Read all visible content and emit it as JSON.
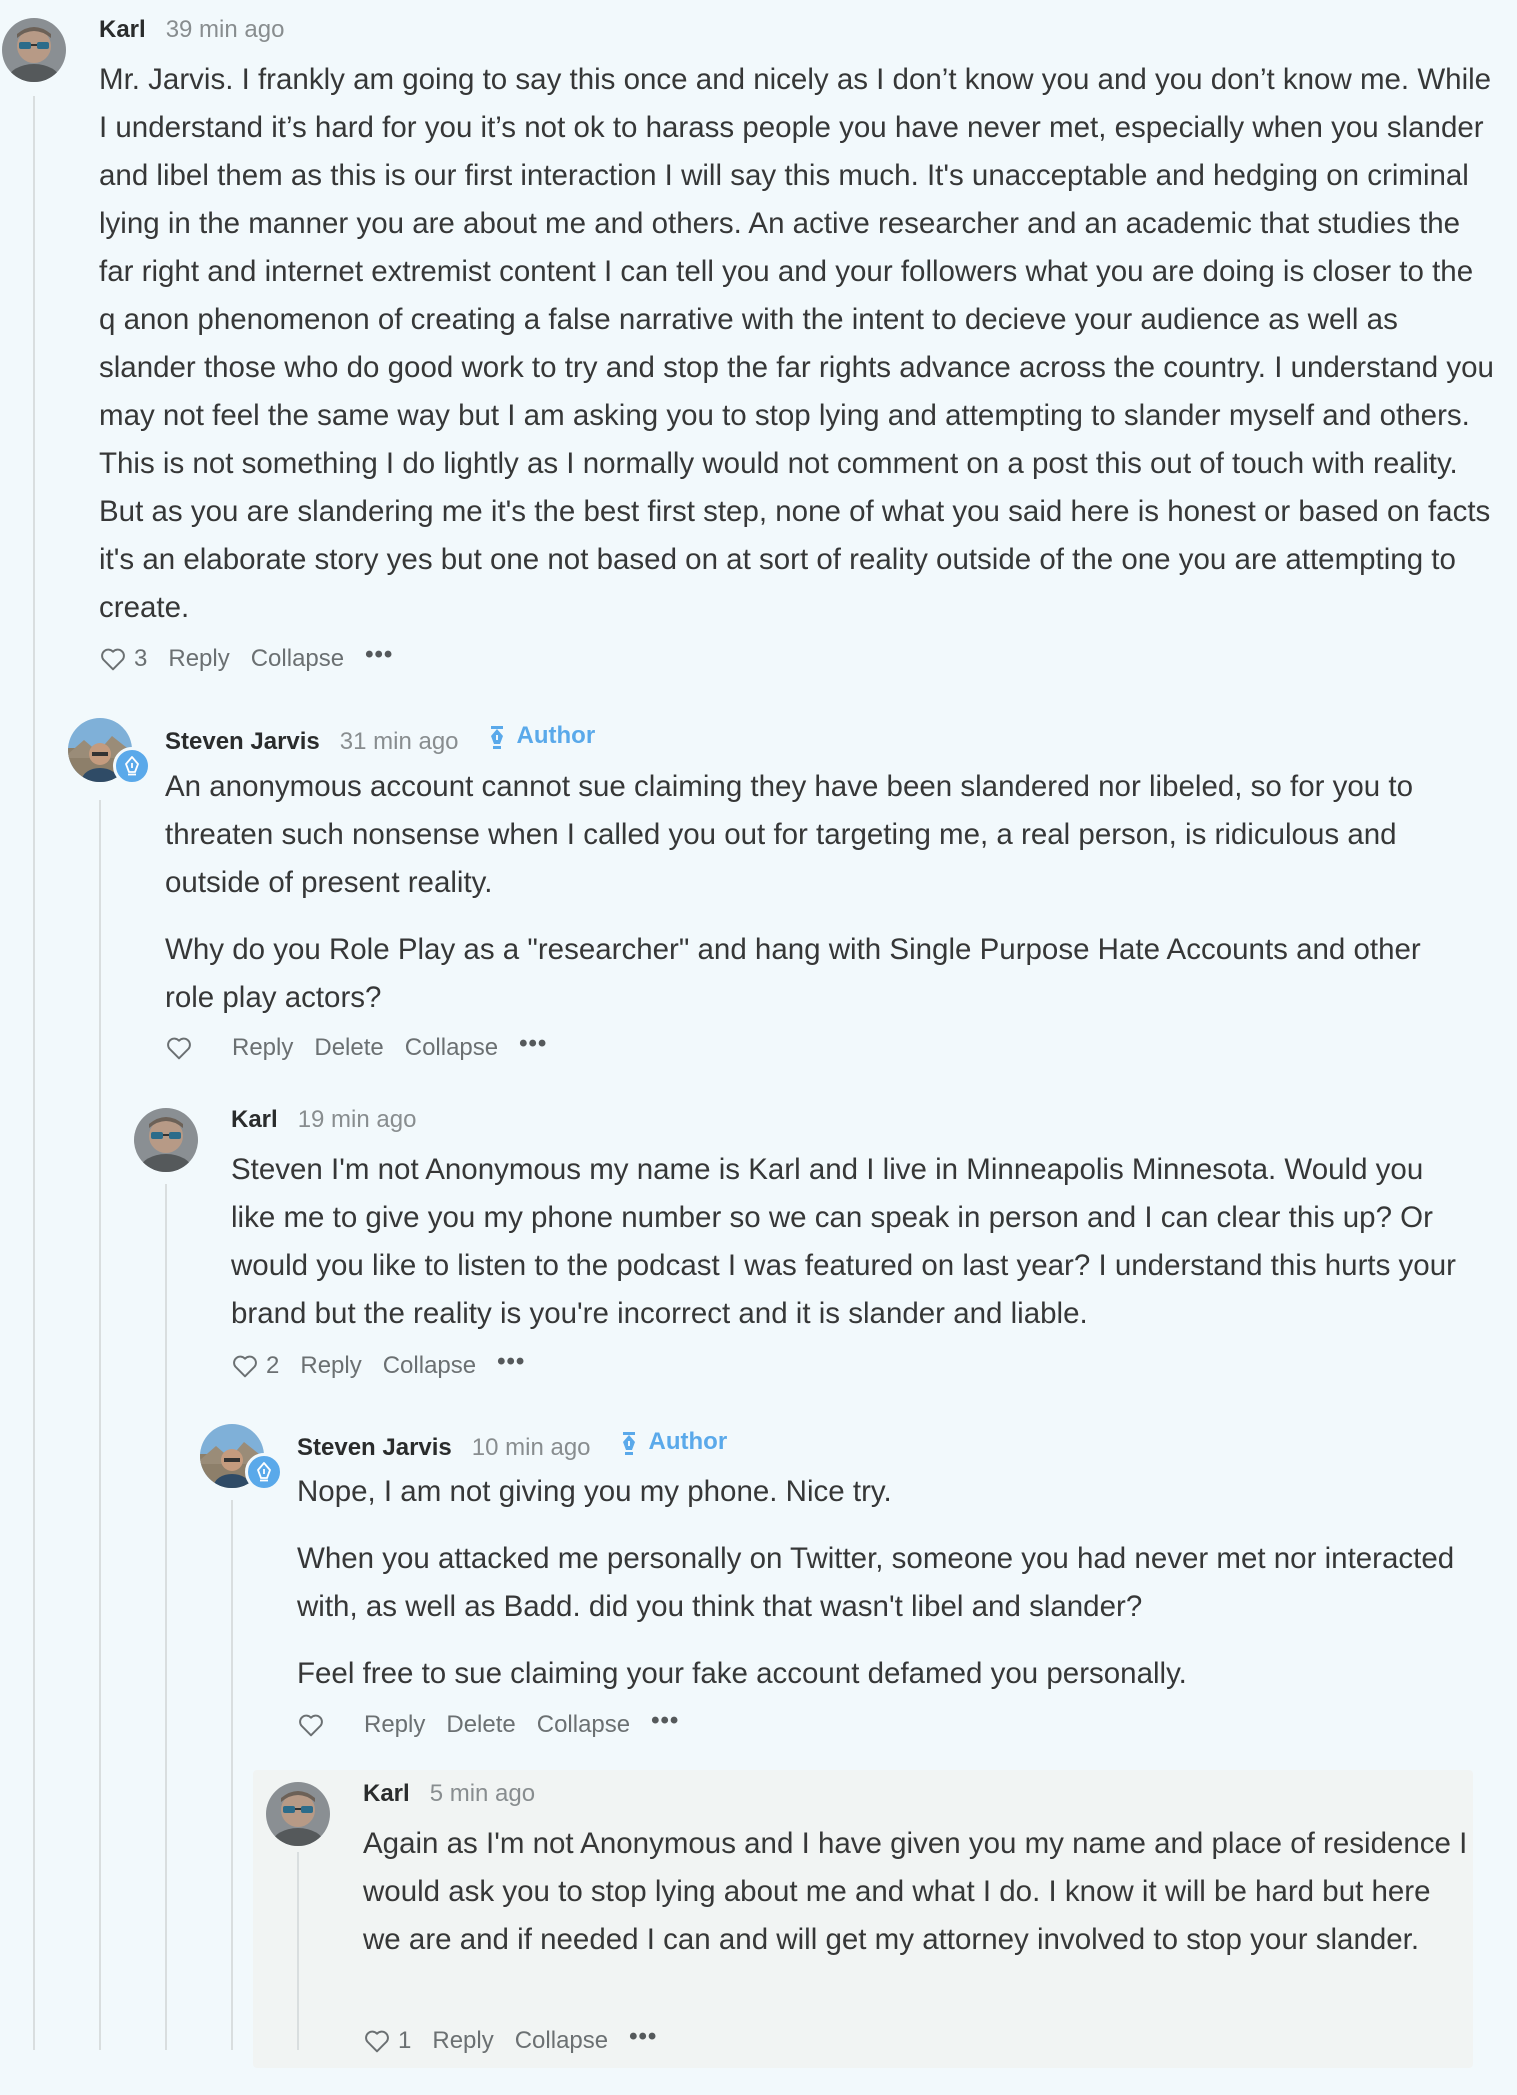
{
  "comments": [
    {
      "name": "Karl",
      "time": "39 min ago",
      "paragraphs": [
        "Mr. Jarvis. I frankly am going to say this once and nicely as I don’t know you and you don’t know me. While I understand it’s hard for you it’s not ok to harass people you have never met, especially when you slander and libel them as this is our first interaction I will say this much. It's unacceptable and hedging on criminal lying in the manner you are about me and others. An active researcher and an academic that studies the far right and internet extremist content I can tell you and your followers what you are doing is closer to the q anon phenomenon of creating a false narrative with the intent to decieve your audience as well as slander those who do good work to try and stop the far rights advance across the country. I understand you may not feel the same way but I am asking you to stop lying and attempting to slander myself and others. This is not something I do lightly as I normally would not comment on a post this out of touch with reality. But as you are slandering me it's the best first step, none of what you said here is honest or based on facts it's an elaborate story yes but one not based on at sort of reality outside of the one you are attempting to create."
      ],
      "likes": "3",
      "reply": "Reply",
      "collapse": "Collapse",
      "more": "•••"
    },
    {
      "name": "Steven Jarvis",
      "time": "31 min ago",
      "author_tag": "Author",
      "paragraphs": [
        "An anonymous account cannot sue claiming they have been slandered nor libeled, so for you to threaten such nonsense when I called you out for targeting me, a real person, is ridiculous and outside of present reality.",
        "Why do you Role Play as a \"researcher\" and hang with Single Purpose Hate Accounts and other role play actors?"
      ],
      "reply": "Reply",
      "delete": "Delete",
      "collapse": "Collapse",
      "more": "•••"
    },
    {
      "name": "Karl",
      "time": "19 min ago",
      "paragraphs": [
        "Steven I'm not Anonymous my name is Karl and I live in Minneapolis Minnesota. Would you like me to give you my phone number so we can speak in person and I can clear this up? Or would you like to listen to the podcast I was featured on last year? I understand this hurts your brand but the reality is you're incorrect and it is slander and liable."
      ],
      "likes": "2",
      "reply": "Reply",
      "collapse": "Collapse",
      "more": "•••"
    },
    {
      "name": "Steven Jarvis",
      "time": "10 min ago",
      "author_tag": "Author",
      "paragraphs": [
        "Nope, I am not giving you my phone. Nice try.",
        "When you attacked me personally on Twitter, someone you had never met nor interacted with, as well as Badd. did you think that wasn't libel and slander?",
        "Feel free to sue claiming your fake account defamed you personally."
      ],
      "reply": "Reply",
      "delete": "Delete",
      "collapse": "Collapse",
      "more": "•••"
    },
    {
      "name": "Karl",
      "time": "5 min ago",
      "paragraphs": [
        "Again as I'm not Anonymous and I have given you my name and place of residence I would ask you to stop lying about me and what I do. I know it will be hard but here we are and if needed I can and will get my attorney involved to stop your slander."
      ],
      "likes": "1",
      "reply": "Reply",
      "collapse": "Collapse",
      "more": "•••"
    }
  ],
  "icons": {
    "like": "heart-outline-icon",
    "author": "fountain-pen-icon",
    "more": "ellipsis-icon"
  },
  "colors": {
    "background": "#f2f9fc",
    "accent": "#5aa9ea",
    "highlight": "#f1f4f3",
    "thread_line": "#d9dedf"
  }
}
